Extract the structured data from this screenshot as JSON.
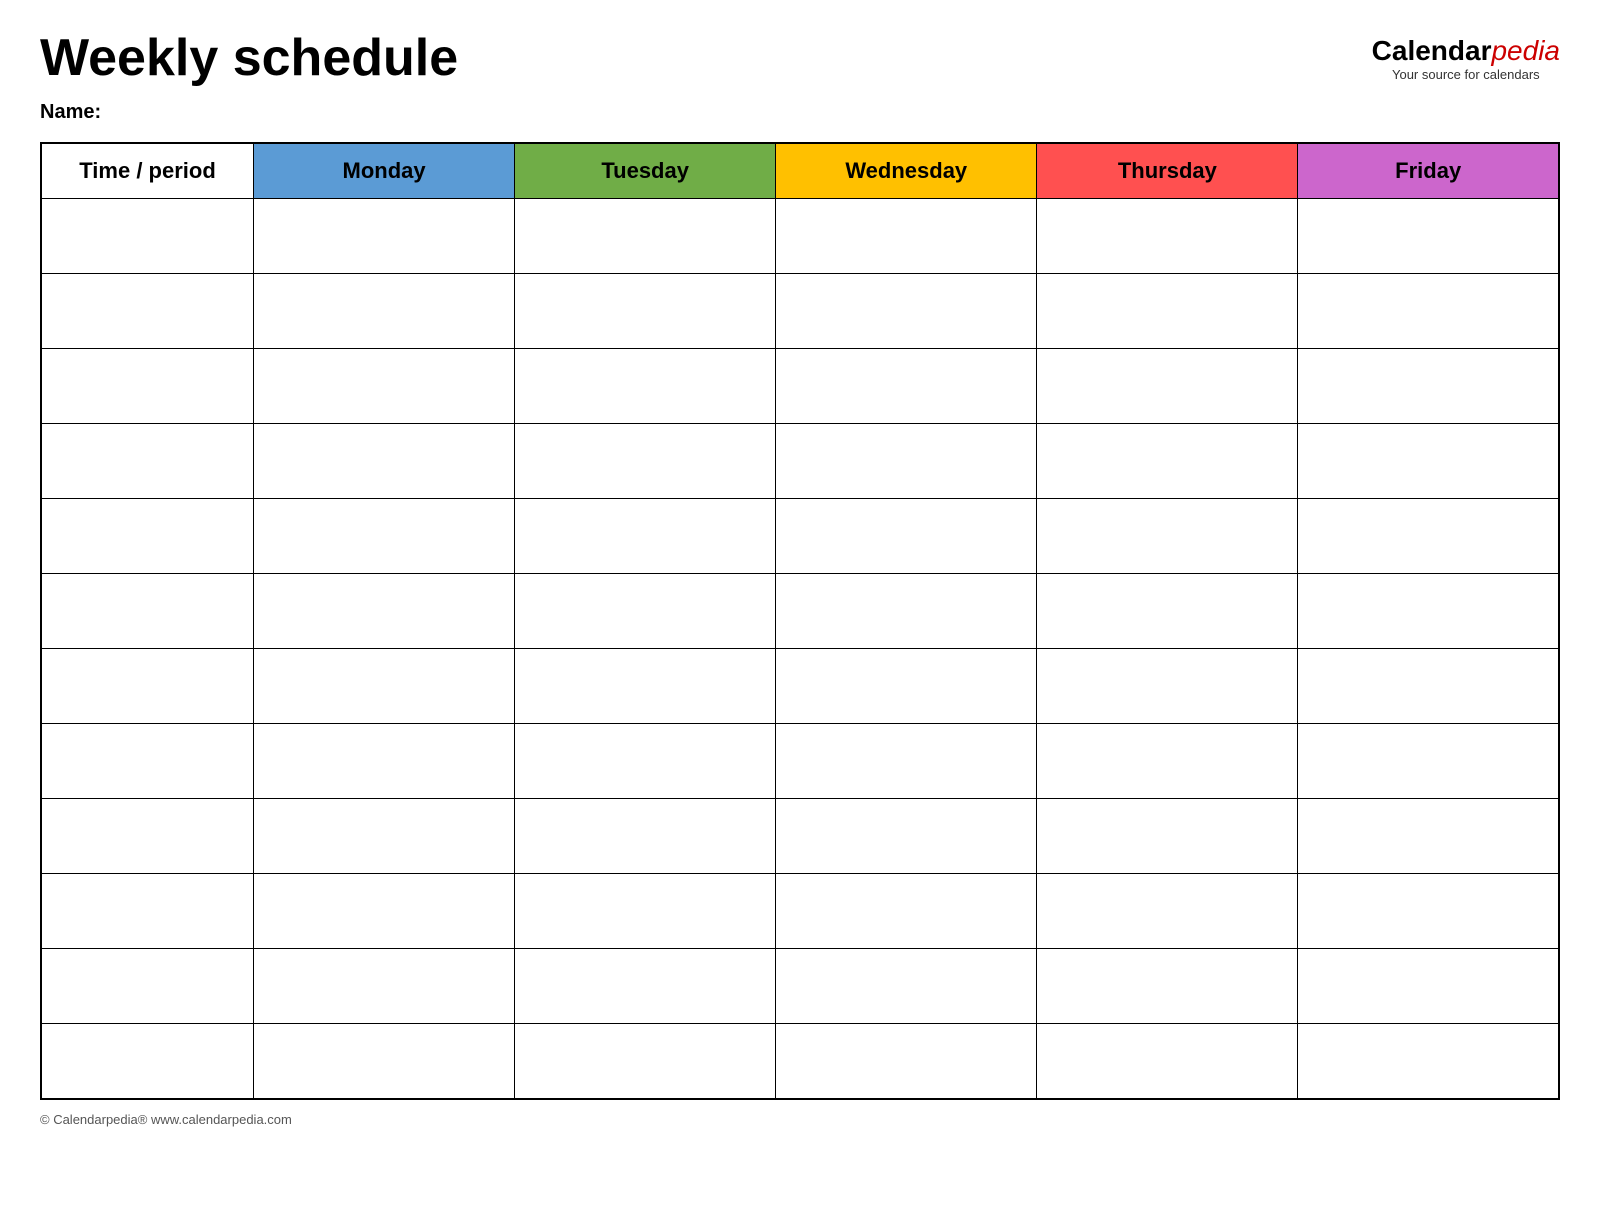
{
  "header": {
    "title": "Weekly schedule",
    "logo_calendar": "Calendar",
    "logo_pedia": "pedia",
    "logo_sub": "Your source for calendars"
  },
  "name_label": "Name:",
  "table": {
    "columns": [
      {
        "key": "time",
        "label": "Time / period",
        "color_class": "col-time"
      },
      {
        "key": "monday",
        "label": "Monday",
        "color_class": "col-monday"
      },
      {
        "key": "tuesday",
        "label": "Tuesday",
        "color_class": "col-tuesday"
      },
      {
        "key": "wednesday",
        "label": "Wednesday",
        "color_class": "col-wednesday"
      },
      {
        "key": "thursday",
        "label": "Thursday",
        "color_class": "col-thursday"
      },
      {
        "key": "friday",
        "label": "Friday",
        "color_class": "col-friday"
      }
    ],
    "row_count": 12
  },
  "footer": {
    "text": "© Calendarpedia®  www.calendarpedia.com"
  }
}
